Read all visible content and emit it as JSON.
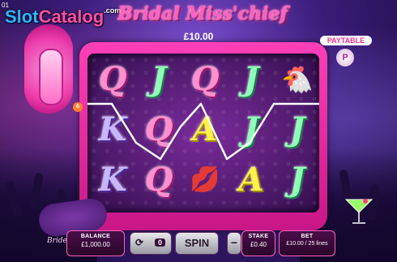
{
  "corner_id": "01",
  "logo": {
    "part1": "Slot",
    "part2": "Catalog",
    "suffix": ".com"
  },
  "game_title": "Bridal Miss'chief",
  "jackpot_display": "£10.00",
  "paytable": {
    "label": "PAYTABLE",
    "button": "P"
  },
  "reels": [
    [
      "Q",
      "K",
      "K"
    ],
    [
      "J",
      "Q",
      "Q"
    ],
    [
      "Q",
      "A",
      "lips"
    ],
    [
      "J",
      "J",
      "A"
    ],
    [
      "hen",
      "J",
      "J"
    ]
  ],
  "win_line_badge": "6",
  "controls": {
    "balance_label": "BALANCE",
    "balance_value": "£1,000.00",
    "autoplay_value": "0",
    "spin_label": "SPIN",
    "stake_minus": "−",
    "stake_label": "STAKE",
    "stake_value": "£0.40",
    "bet_label": "BET",
    "bet_value": "£10.00 / 25 lines"
  },
  "sign_text": "Bride To B",
  "colors": {
    "accent_pink": "#ff3fb8",
    "win_line": "#ffffff"
  }
}
